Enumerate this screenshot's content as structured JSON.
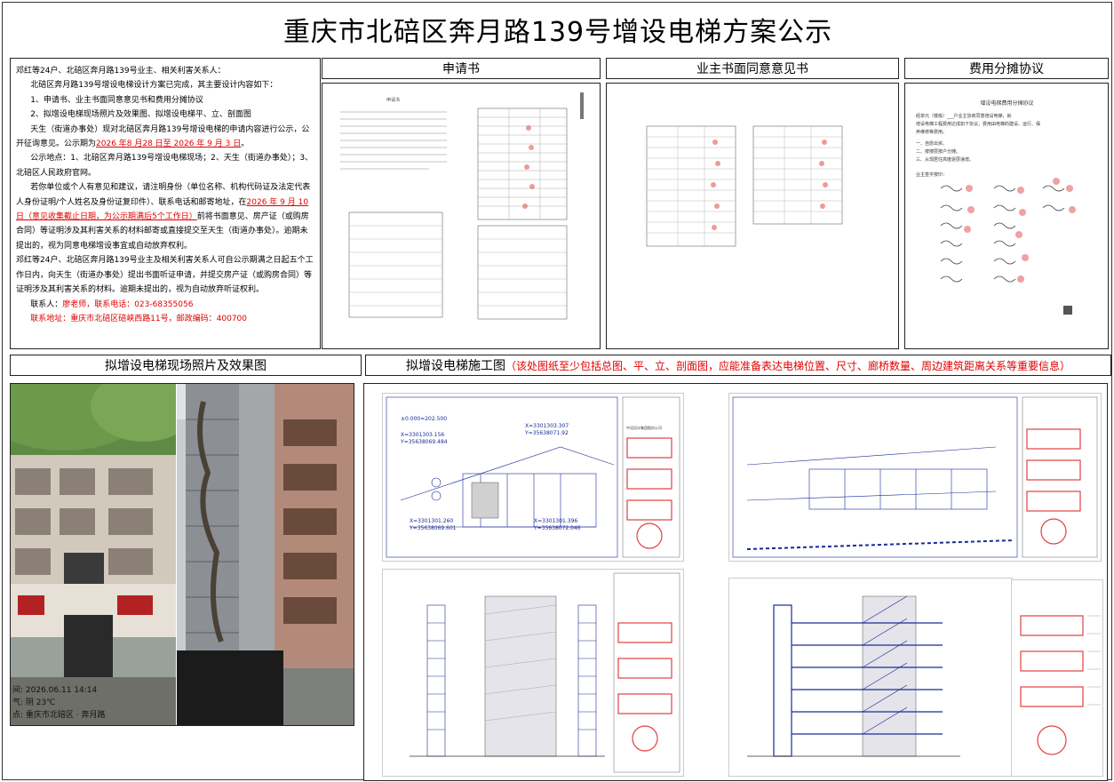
{
  "title": "重庆市北碚区奔月路139号增设电梯方案公示",
  "notice": {
    "line1": "邓红等24户、北碚区奔月路139号业主、相关利害关系人：",
    "line2": "北碚区奔月路139号增设电梯设计方案已完成，其主要设计内容如下：",
    "item1": "1、申请书、业主书面同意意见书和费用分摊协议",
    "item2": "2、拟增设电梯现场照片及效果图、拟增设电梯平、立、剖面图",
    "para1_a": "天生（街道办事处）现对北碚区奔月路139号增设电梯的申请内容进行公示，公开征询意见。公示期为",
    "para1_date": "2026 年8 月28  日至  2026  年  9 月  3  日",
    "para1_end": "。",
    "para2": "公示地点：1、北碚区奔月路139号增设电梯现场；2、天生（街道办事处）；3、北碚区人民政府官网。",
    "para3_a": "若你单位或个人有意见和建议，请注明身份（单位名称、机构代码证及法定代表人身份证明/个人姓名及身份证复印件）、联系电话和邮寄地址，在",
    "para3_date": "2026 年 9 月  10  日（意见收集截止日期，为公示期满后5个工作日）",
    "para3_b": "前将书面意见、房产证（或购房合同）等证明涉及其利害关系的材料邮寄或直接提交至天生（街道办事处）。逾期未提出的，视为同意电梯增设事宜或自动放弃权利。",
    "para4": "邓红等24户、北碚区奔月路139号业主及相关利害关系人可自公示期满之日起五个工作日内，向天生（街道办事处）提出书面听证申请，并提交房产证（或购房合同）等证明涉及其利害关系的材料。逾期未提出的，视为自动放弃听证权利。",
    "contact_label": "联系人：",
    "contact": "廖老师，联系电话：023-68355056",
    "address": "联系地址：重庆市北碚区碚峡西路11号，邮政编码：400700"
  },
  "sections": {
    "application": "申请书",
    "consent": "业主书面同意意见书",
    "cost": "费用分摊协议",
    "photos": "拟增设电梯现场照片及效果图",
    "drawings_title": "拟增设电梯施工图",
    "drawings_note": "（该处图纸至少包括总图、平、立、剖面图，应能准备表达电梯位置、尺寸、廊桥数量、周边建筑距离关系等重要信息）"
  },
  "doc_application": {
    "heading": "申请书"
  },
  "doc_cost": {
    "heading": "增设电梯费用分摊协议",
    "line1": "经单元（楼栋）___户业主协商同意增设电梯，就",
    "line2": "增设电梯工程费用达成如下协议，费用由电梯的建设、运行、保",
    "line3": "养维修等费用。",
    "item1": "一、自愿出资。",
    "item2": "二、按楼层按户分摊。",
    "item3": "三、从现居住高度逐层递增。",
    "sign": "业主签字按印："
  },
  "photo_overlay": {
    "time_label": "间:",
    "time": "2026.06.11 14:14",
    "weather_label": "气:",
    "weather": "阴 23℃",
    "place_label": "点:",
    "place": "重庆市北碚区 · 奔月路"
  },
  "plan1": {
    "coord1": "X=3301303.156",
    "coord1b": "Y=35638069.484",
    "coord2": "X=3301303.307",
    "coord2b": "Y=35638071.92",
    "coord3": "X=3301301.260",
    "coord3b": "Y=35638069.601",
    "coord4": "X=3301301.396",
    "coord4b": "Y=35638072.046",
    "elev": "±0.000=202.500",
    "company": "中设设计集团股份公司"
  },
  "colors": {
    "red": "#e00000",
    "stamp": "#dc1e1e",
    "blueprint": "#1a2a9a"
  }
}
